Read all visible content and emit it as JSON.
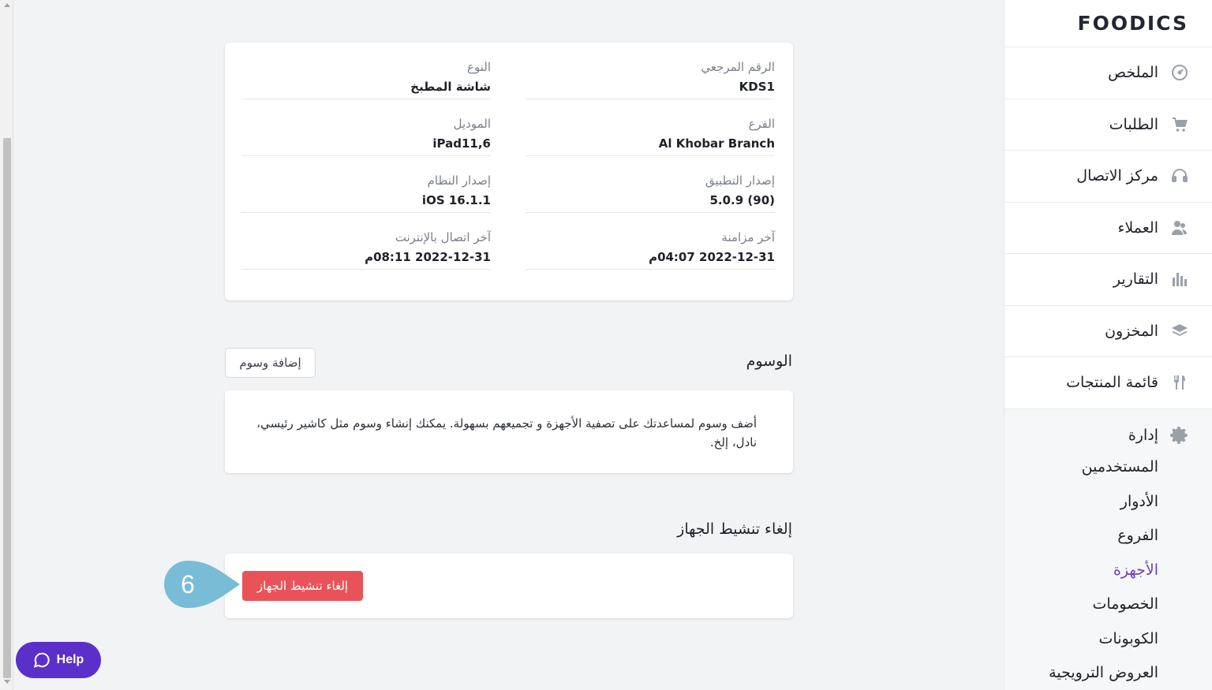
{
  "brand": {
    "logo": "FOODICS"
  },
  "sidebar": {
    "items": [
      {
        "label": "الملخص",
        "icon": "dashboard-icon"
      },
      {
        "label": "الطلبات",
        "icon": "cart-icon"
      },
      {
        "label": "مركز الاتصال",
        "icon": "headset-icon"
      },
      {
        "label": "العملاء",
        "icon": "users-icon"
      },
      {
        "label": "التقارير",
        "icon": "chart-icon"
      },
      {
        "label": "المخزون",
        "icon": "layers-icon"
      },
      {
        "label": "قائمة المنتجات",
        "icon": "utensils-icon"
      }
    ],
    "admin": {
      "label": "إدارة",
      "icon": "gear-icon",
      "items": [
        "المستخدمين",
        "الأدوار",
        "الفروع",
        "الأجهزة",
        "الخصومات",
        "الكوبونات",
        "العروض الترويجية"
      ],
      "active": "الأجهزة",
      "accent": "#6a42c2"
    }
  },
  "details": {
    "fields": [
      {
        "label": "الرقم المرجعي",
        "value": "KDS1"
      },
      {
        "label": "النوع",
        "value": "شاشة المطبخ"
      },
      {
        "label": "الفرع",
        "value": "Al Khobar Branch"
      },
      {
        "label": "الموديل",
        "value": "iPad11,6"
      },
      {
        "label": "إصدار التطبيق",
        "value": "5.0.9 (90)"
      },
      {
        "label": "إصدار النظام",
        "value": "iOS 16.1.1"
      },
      {
        "label": "آخر مزامنة",
        "value": "2022-12-31 04:07م"
      },
      {
        "label": "آخر اتصال بالإنترنت",
        "value": "2022-12-31 08:11م"
      }
    ]
  },
  "tags": {
    "title": "الوسوم",
    "add_button": "إضافة وسوم",
    "empty_text": "أضف وسوم لمساعدتك على تصفية الأجهزة و تجميعهم بسهولة. يمكنك إنشاء وسوم مثل كاشير رئيسي، نادل، إلخ."
  },
  "deactivate": {
    "title": "إلغاء تنشيط الجهاز",
    "button": "إلغاء تنشيط الجهاز",
    "color": "#e8535a"
  },
  "callout": {
    "number": "6",
    "color": "#79bcd6"
  },
  "help": {
    "label": "Help",
    "color": "#5b2fc9"
  }
}
